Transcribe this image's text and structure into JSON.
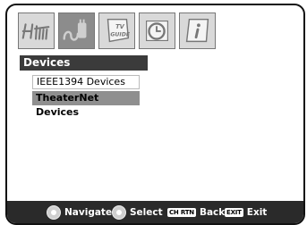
{
  "tabs": [
    {
      "icon": "antenna-icon",
      "selected": false
    },
    {
      "icon": "plug-icon",
      "selected": true
    },
    {
      "icon": "tv-guide-icon",
      "label": "TV GUIDE",
      "selected": false
    },
    {
      "icon": "clock-icon",
      "selected": false
    },
    {
      "icon": "info-icon",
      "selected": false
    }
  ],
  "panel": {
    "title": "Devices",
    "items": [
      "IEEE1394 Devices",
      "TheaterNet Devices"
    ],
    "selected_index": 1
  },
  "footer": {
    "navigate": "Navigate",
    "select": "Select",
    "back_key": "CH RTN",
    "back": "Back",
    "exit_key": "EXIT",
    "exit": "Exit"
  }
}
